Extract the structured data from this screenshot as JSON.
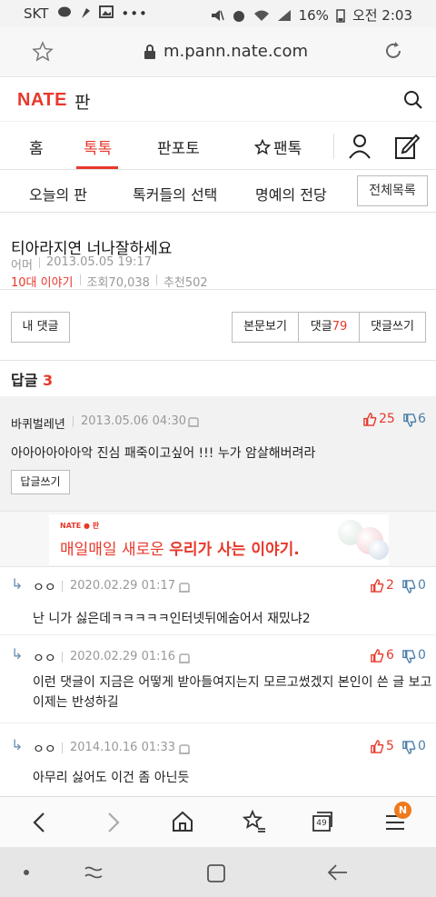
{
  "status_bar": {
    "carrier": "SKT",
    "battery": "16%",
    "time": "오전 2:03"
  },
  "browser": {
    "url": "m.pann.nate.com",
    "tab_count": "49",
    "menu_badge": "N"
  },
  "site": {
    "logo": "NATE",
    "logo_suffix": "판"
  },
  "tabs": [
    "홈",
    "톡톡",
    "판포토",
    "팬톡"
  ],
  "active_tab": "톡톡",
  "subnav": {
    "items": [
      "오늘의 판",
      "톡커들의 선택",
      "명예의 전당"
    ],
    "all_button": "전체목록"
  },
  "post": {
    "title": "티아라지연 너나잘하세요",
    "author": "어머",
    "date": "2013.05.05 19:17",
    "category": "10대 이야기",
    "views": "조회70,038",
    "recommend": "추천502"
  },
  "post_buttons": {
    "my_comments": "내 댓글",
    "view_body": "본문보기",
    "comments_label": "댓글",
    "comments_count": "79",
    "write_comment": "댓글쓰기"
  },
  "replies_header": {
    "label": "답글",
    "count": "3"
  },
  "main_comment": {
    "author": "바퀴벌레년",
    "date": "2013.05.06 04:30",
    "up": "25",
    "down": "6",
    "text": "아아아아아아악 진심 패죽이고싶어 !!! 누가 암살해버려라",
    "reply_button": "답글쓰기"
  },
  "banner": {
    "small_logo": "NATE ● 판",
    "text_a": "매일매일 새로운 ",
    "text_b": "우리가 사는 이야기."
  },
  "replies": [
    {
      "author": "ㅇㅇ",
      "date": "2020.02.29 01:17",
      "up": "2",
      "down": "0",
      "text": "난 니가 싫은데ㅋㅋㅋㅋㅋ인터넷뒤에숨어서 재밌냐2"
    },
    {
      "author": "ㅇㅇ",
      "date": "2020.02.29 01:16",
      "up": "6",
      "down": "0",
      "text": "이런 댓글이 지금은 어떻게 받아들여지는지 모르고썼겠지 본인이 쓴 글 보고 이제는 반성하길"
    },
    {
      "author": "ㅇㅇ",
      "date": "2014.10.16 01:33",
      "up": "5",
      "down": "0",
      "text": "아무리 싫어도 이건 좀 아닌듯"
    }
  ],
  "colors": {
    "accent": "#e8382b",
    "down_blue": "#4b7fa8"
  }
}
